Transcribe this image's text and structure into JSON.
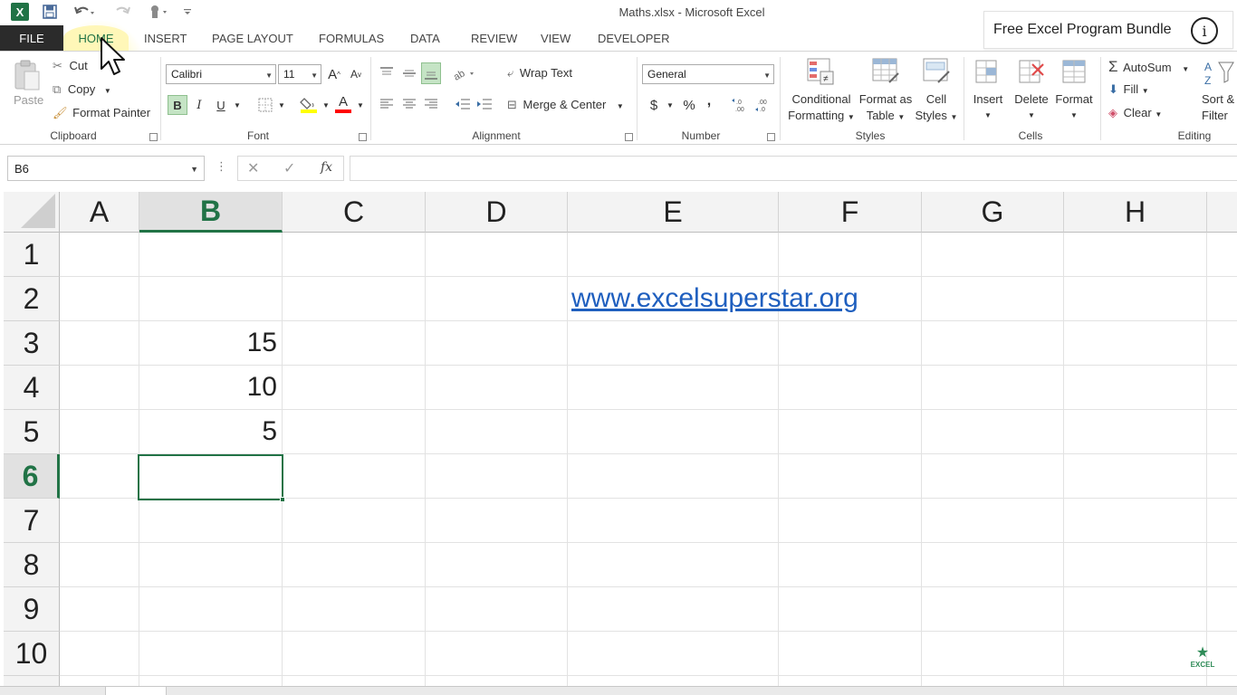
{
  "window": {
    "title": "Maths.xlsx - Microsoft Excel",
    "app_icon_letter": "X"
  },
  "promo": {
    "text": "Free Excel Program Bundle",
    "info_glyph": "i"
  },
  "ribbon_tabs": {
    "file": "FILE",
    "home": "HOME",
    "insert": "INSERT",
    "page_layout": "PAGE LAYOUT",
    "formulas": "FORMULAS",
    "data": "DATA",
    "review": "REVIEW",
    "view": "VIEW",
    "developer": "DEVELOPER",
    "active": "home"
  },
  "clipboard": {
    "paste": "Paste",
    "cut": "Cut",
    "copy": "Copy",
    "format_painter": "Format Painter",
    "group_label": "Clipboard"
  },
  "font": {
    "family": "Calibri",
    "size": "11",
    "bold": "B",
    "italic": "I",
    "underline": "U",
    "grow": "A",
    "shrink": "A",
    "font_color_glyph": "A",
    "group_label": "Font",
    "fill_color": "#ffff00",
    "font_color": "#ff0000"
  },
  "alignment": {
    "wrap_text": "Wrap Text",
    "merge_center": "Merge & Center",
    "group_label": "Alignment"
  },
  "number": {
    "format": "General",
    "currency": "$",
    "percent": "%",
    "comma": ",",
    "group_label": "Number"
  },
  "styles": {
    "conditional_1": "Conditional",
    "conditional_2": "Formatting",
    "format_as_1": "Format as",
    "format_as_2": "Table",
    "cell_styles_1": "Cell",
    "cell_styles_2": "Styles",
    "group_label": "Styles"
  },
  "cells": {
    "insert": "Insert",
    "delete": "Delete",
    "format": "Format",
    "group_label": "Cells"
  },
  "editing": {
    "autosum": "AutoSum",
    "fill": "Fill",
    "clear": "Clear",
    "sort_1": "Sort &",
    "sort_2": "Filter",
    "group_label": "Editing"
  },
  "formula_bar": {
    "name_box": "B6",
    "fx": "fx",
    "formula": ""
  },
  "sheet": {
    "columns": [
      "A",
      "B",
      "C",
      "D",
      "E",
      "F",
      "G",
      "H"
    ],
    "rows": [
      "1",
      "2",
      "3",
      "4",
      "5",
      "6",
      "7",
      "8",
      "9",
      "10"
    ],
    "selected_column": "B",
    "selected_row": "6",
    "cells": {
      "B3": "15",
      "B4": "10",
      "B5": "5",
      "E2": "www.excelsuperstar.org"
    }
  },
  "watermark": {
    "text": "EXCEL"
  },
  "colors": {
    "accent_green": "#217346",
    "link_blue": "#1f5fbf",
    "file_tab_bg": "#2b2b2b"
  }
}
